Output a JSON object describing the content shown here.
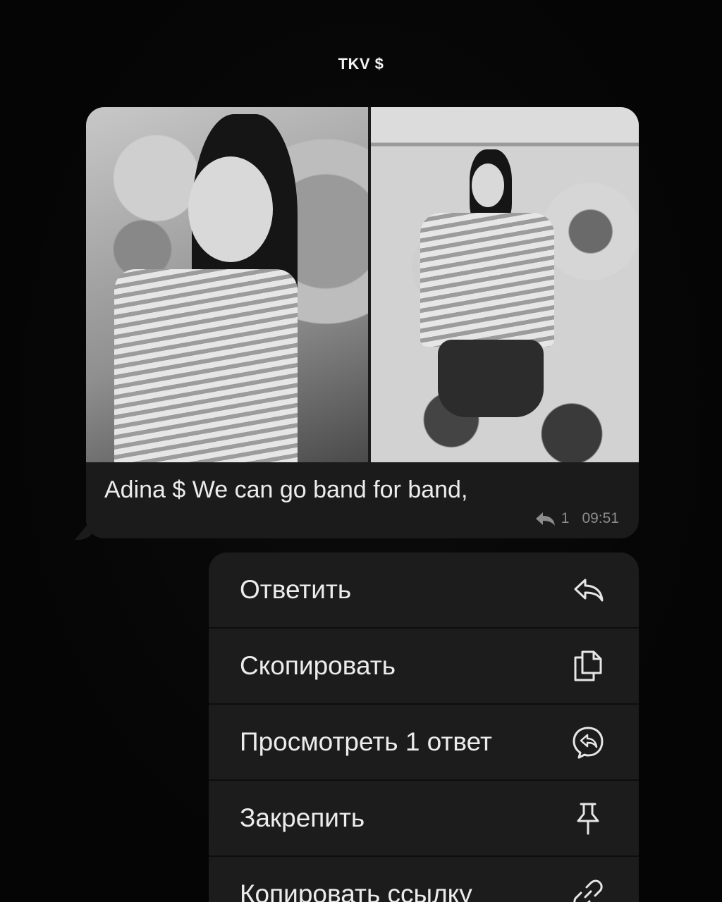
{
  "header": {
    "title": "TKV $"
  },
  "message": {
    "caption": "Adina $ We can go band for band,",
    "reply_count": "1",
    "time": "09:51",
    "photos": [
      "photo-left",
      "photo-right"
    ]
  },
  "menu": {
    "items": [
      {
        "label": "Ответить",
        "icon": "reply-icon"
      },
      {
        "label": "Скопировать",
        "icon": "copy-icon"
      },
      {
        "label": "Просмотреть 1 ответ",
        "icon": "view-replies-icon"
      },
      {
        "label": "Закрепить",
        "icon": "pin-icon"
      },
      {
        "label": "Копировать ссылку",
        "icon": "link-icon"
      }
    ]
  },
  "colors": {
    "background": "#050505",
    "bubble": "#1b1b1b",
    "menu": "#1c1c1c",
    "text": "#ececec",
    "meta": "#8c8c8c"
  }
}
